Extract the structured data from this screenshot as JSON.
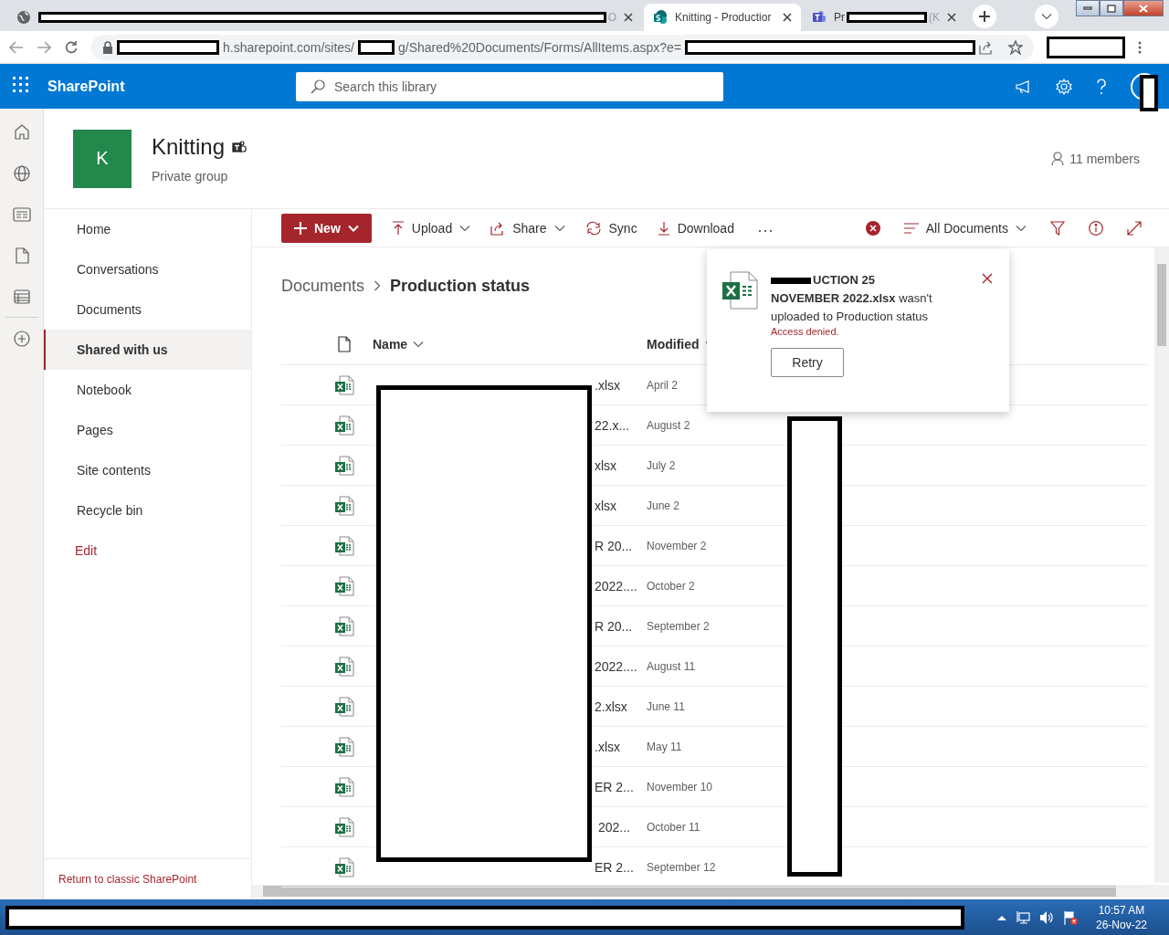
{
  "browser": {
    "tabs": [
      {
        "kind": "globe",
        "title_end": "O",
        "redacted": true,
        "selected": false
      },
      {
        "kind": "sharepoint",
        "title": "Knitting - Productior",
        "redacted": false,
        "selected": true
      },
      {
        "kind": "teams",
        "title_start": "Pr",
        "title_end": "(K",
        "redacted": true,
        "selected": false
      }
    ],
    "url_parts": [
      "h.sharepoint.com/sites/",
      "g/Shared%20Documents/Forms/AllItems.aspx?e="
    ]
  },
  "suite_bar": {
    "app_name": "SharePoint",
    "search": {
      "placeholder": "Search this library"
    }
  },
  "site": {
    "logo_letter": "K",
    "name": "Knitting",
    "subtitle": "Private group",
    "members": "11 members"
  },
  "nav": {
    "items": [
      {
        "label": "Home",
        "selected": false
      },
      {
        "label": "Conversations",
        "selected": false
      },
      {
        "label": "Documents",
        "selected": false
      },
      {
        "label": "Shared with us",
        "selected": true
      },
      {
        "label": "Notebook",
        "selected": false
      },
      {
        "label": "Pages",
        "selected": false
      },
      {
        "label": "Site contents",
        "selected": false
      },
      {
        "label": "Recycle bin",
        "selected": false
      }
    ],
    "edit_label": "Edit",
    "footer_link": "Return to classic SharePoint"
  },
  "command_bar": {
    "new_label": "New",
    "actions": [
      {
        "kind": "upload",
        "label": "Upload",
        "menu": true
      },
      {
        "kind": "share",
        "label": "Share",
        "menu": true
      },
      {
        "kind": "sync",
        "label": "Sync",
        "menu": false
      },
      {
        "kind": "download",
        "label": "Download",
        "menu": false
      }
    ],
    "view_label": "All Documents"
  },
  "breadcrumb": [
    "Documents",
    "Production status"
  ],
  "table": {
    "columns": [
      "Name",
      "Modified"
    ],
    "rows": [
      {
        "name": ".xlsx",
        "modified": "April 2"
      },
      {
        "name": "22.x...",
        "modified": "August 2"
      },
      {
        "name": "xlsx",
        "modified": "July 2"
      },
      {
        "name": "xlsx",
        "modified": "June 2"
      },
      {
        "name": "R 20...",
        "modified": "November 2"
      },
      {
        "name": "2022....",
        "modified": "October 2"
      },
      {
        "name": "R 20...",
        "modified": "September 2"
      },
      {
        "name": "2022....",
        "modified": "August 11"
      },
      {
        "name": "2.xlsx",
        "modified": "June 11"
      },
      {
        "name": ".xlsx",
        "modified": "May 11"
      },
      {
        "name": "ER 2...",
        "modified": "November 10"
      },
      {
        "name": " 202...",
        "modified": "October 11"
      },
      {
        "name": "ER 2...",
        "modified": "September 12"
      }
    ]
  },
  "upload_error": {
    "message_start": "UCTION 25",
    "message": "**NOVEMBER 2022.xlsx** wasn't uploaded to Production status",
    "error": "Access denied.",
    "retry": "Retry"
  },
  "taskbar": {
    "time": "10:57 AM",
    "date": "26-Nov-22"
  }
}
